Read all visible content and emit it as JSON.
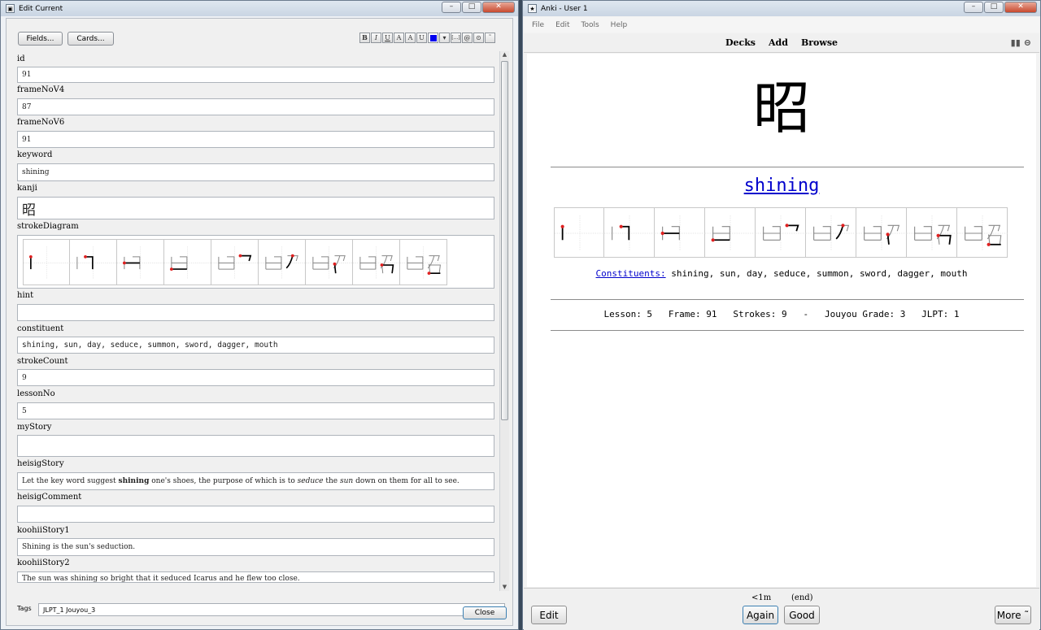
{
  "edit_window": {
    "title": "Edit Current",
    "fields_button": "Fields...",
    "cards_button": "Cards...",
    "format_buttons": [
      "B",
      "I",
      "U",
      "A",
      "A",
      "U",
      "",
      "",
      "[...]",
      "@",
      "⊙",
      "˜"
    ],
    "fields": [
      {
        "name": "id",
        "value": "91"
      },
      {
        "name": "frameNoV4",
        "value": "87"
      },
      {
        "name": "frameNoV6",
        "value": "91"
      },
      {
        "name": "keyword",
        "value": "shining"
      },
      {
        "name": "kanji",
        "value": "昭"
      },
      {
        "name": "strokeDiagram",
        "value": ""
      },
      {
        "name": "hint",
        "value": ""
      },
      {
        "name": "constituent",
        "value": "shining, sun, day, seduce, summon, sword, dagger, mouth"
      },
      {
        "name": "strokeCount",
        "value": "9"
      },
      {
        "name": "lessonNo",
        "value": "5"
      },
      {
        "name": "myStory",
        "value": ""
      },
      {
        "name": "heisigStory",
        "value": "",
        "parts": [
          "Let the key word suggest ",
          "shining",
          " one's shoes, the purpose of which is to ",
          "seduce",
          " the ",
          "sun",
          " down on them for all to see."
        ]
      },
      {
        "name": "heisigComment",
        "value": ""
      },
      {
        "name": "koohiiStory1",
        "value": "Shining is the sun's seduction."
      },
      {
        "name": "koohiiStory2",
        "value": "The sun was shining so bright that it seduced Icarus and he flew too close."
      }
    ],
    "tags_label": "Tags",
    "tags_value": "JLPT_1 Jouyou_3",
    "close_button": "Close"
  },
  "anki_window": {
    "title": "Anki - User 1",
    "menu": [
      "File",
      "Edit",
      "Tools",
      "Help"
    ],
    "toolbar": {
      "decks": "Decks",
      "add": "Add",
      "browse": "Browse"
    },
    "card": {
      "kanji": "昭",
      "keyword": "shining",
      "constituents_label": "Constituents:",
      "constituents": " shining, sun, day, seduce, summon, sword, dagger, mouth",
      "meta": "Lesson: 5   Frame: 91   Strokes: 9   -   Jouyou Grade: 3   JLPT: 1"
    },
    "bottom": {
      "edit": "Edit",
      "again": "Again",
      "good": "Good",
      "more": "More ˜",
      "again_due": "<1m",
      "good_due": "(end)"
    }
  },
  "stroke_count": 9,
  "accent_colors": {
    "link": "#0000cc",
    "stroke_start": "#e02020"
  }
}
